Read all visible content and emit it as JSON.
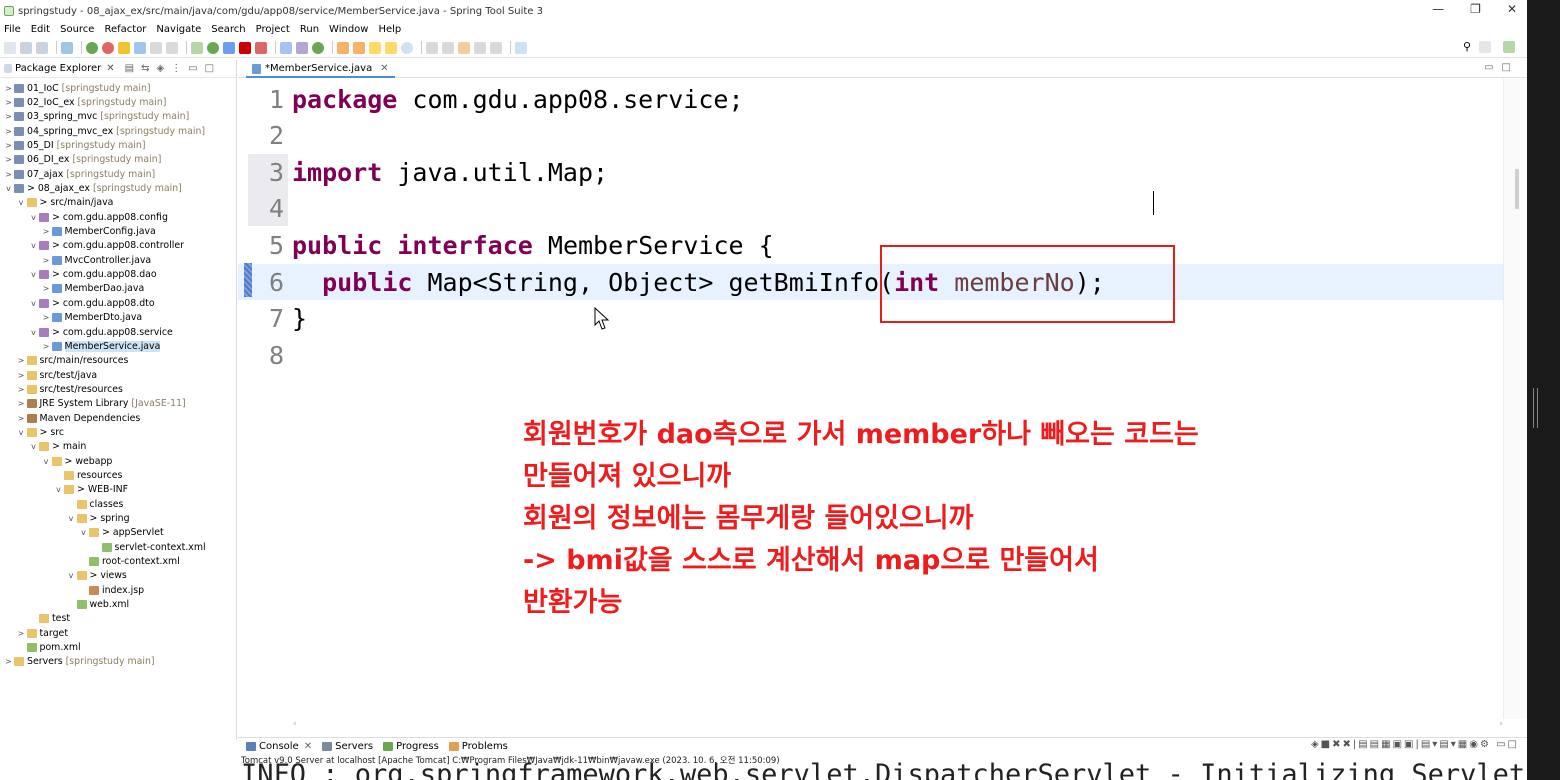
{
  "window": {
    "title": "springstudy - 08_ajax_ex/src/main/java/com/gdu/app08/service/MemberService.java - Spring Tool Suite 3",
    "controls": [
      "—",
      "❐",
      "✕"
    ]
  },
  "menubar": {
    "items": [
      "File",
      "Edit",
      "Source",
      "Refactor",
      "Navigate",
      "Search",
      "Project",
      "Run",
      "Window",
      "Help"
    ]
  },
  "package_explorer": {
    "title": "Package Explorer",
    "tree": [
      {
        "indent": 0,
        "twisty": ">",
        "icon": "project",
        "label": "01_IoC",
        "decoration": "[springstudy main]"
      },
      {
        "indent": 0,
        "twisty": ">",
        "icon": "project",
        "label": "02_IoC_ex",
        "decoration": "[springstudy main]"
      },
      {
        "indent": 0,
        "twisty": ">",
        "icon": "project",
        "label": "03_spring_mvc",
        "decoration": "[springstudy main]"
      },
      {
        "indent": 0,
        "twisty": ">",
        "icon": "project",
        "label": "04_spring_mvc_ex",
        "decoration": "[springstudy main]"
      },
      {
        "indent": 0,
        "twisty": ">",
        "icon": "project",
        "label": "05_DI",
        "decoration": "[springstudy main]"
      },
      {
        "indent": 0,
        "twisty": ">",
        "icon": "project",
        "label": "06_DI_ex",
        "decoration": "[springstudy main]"
      },
      {
        "indent": 0,
        "twisty": ">",
        "icon": "project",
        "label": "07_ajax",
        "decoration": "[springstudy main]"
      },
      {
        "indent": 0,
        "twisty": "v",
        "icon": "project",
        "label": "> 08_ajax_ex",
        "decoration": "[springstudy main]"
      },
      {
        "indent": 1,
        "twisty": "v",
        "icon": "folder",
        "label": "> src/main/java",
        "decoration": ""
      },
      {
        "indent": 2,
        "twisty": "v",
        "icon": "pkg",
        "label": "> com.gdu.app08.config",
        "decoration": ""
      },
      {
        "indent": 3,
        "twisty": ">",
        "icon": "java",
        "label": "MemberConfig.java",
        "decoration": ""
      },
      {
        "indent": 2,
        "twisty": "v",
        "icon": "pkg",
        "label": "> com.gdu.app08.controller",
        "decoration": ""
      },
      {
        "indent": 3,
        "twisty": ">",
        "icon": "java",
        "label": "MvcController.java",
        "decoration": ""
      },
      {
        "indent": 2,
        "twisty": "v",
        "icon": "pkg",
        "label": "> com.gdu.app08.dao",
        "decoration": ""
      },
      {
        "indent": 3,
        "twisty": ">",
        "icon": "java",
        "label": "MemberDao.java",
        "decoration": ""
      },
      {
        "indent": 2,
        "twisty": "v",
        "icon": "pkg",
        "label": "> com.gdu.app08.dto",
        "decoration": ""
      },
      {
        "indent": 3,
        "twisty": ">",
        "icon": "java",
        "label": "MemberDto.java",
        "decoration": ""
      },
      {
        "indent": 2,
        "twisty": "v",
        "icon": "pkg",
        "label": "> com.gdu.app08.service",
        "decoration": ""
      },
      {
        "indent": 3,
        "twisty": ">",
        "icon": "java",
        "label": "MemberService.java",
        "decoration": "",
        "selected": true
      },
      {
        "indent": 1,
        "twisty": ">",
        "icon": "folder",
        "label": "src/main/resources",
        "decoration": ""
      },
      {
        "indent": 1,
        "twisty": ">",
        "icon": "folder",
        "label": "src/test/java",
        "decoration": ""
      },
      {
        "indent": 1,
        "twisty": ">",
        "icon": "folder",
        "label": "src/test/resources",
        "decoration": ""
      },
      {
        "indent": 1,
        "twisty": ">",
        "icon": "lib",
        "label": "JRE System Library",
        "decoration": "[JavaSE-11]"
      },
      {
        "indent": 1,
        "twisty": ">",
        "icon": "lib",
        "label": "Maven Dependencies",
        "decoration": ""
      },
      {
        "indent": 1,
        "twisty": "v",
        "icon": "folder",
        "label": "> src",
        "decoration": ""
      },
      {
        "indent": 2,
        "twisty": "v",
        "icon": "folder",
        "label": "> main",
        "decoration": ""
      },
      {
        "indent": 3,
        "twisty": "v",
        "icon": "folder",
        "label": "> webapp",
        "decoration": ""
      },
      {
        "indent": 4,
        "twisty": "",
        "icon": "folder",
        "label": "resources",
        "decoration": ""
      },
      {
        "indent": 4,
        "twisty": "v",
        "icon": "folder",
        "label": "> WEB-INF",
        "decoration": ""
      },
      {
        "indent": 5,
        "twisty": "",
        "icon": "folder",
        "label": "classes",
        "decoration": ""
      },
      {
        "indent": 5,
        "twisty": "v",
        "icon": "folder",
        "label": "> spring",
        "decoration": ""
      },
      {
        "indent": 6,
        "twisty": "v",
        "icon": "folder",
        "label": "> appServlet",
        "decoration": ""
      },
      {
        "indent": 7,
        "twisty": "",
        "icon": "xml",
        "label": "servlet-context.xml",
        "decoration": ""
      },
      {
        "indent": 6,
        "twisty": "",
        "icon": "xml",
        "label": "root-context.xml",
        "decoration": ""
      },
      {
        "indent": 5,
        "twisty": "v",
        "icon": "folder",
        "label": "> views",
        "decoration": ""
      },
      {
        "indent": 6,
        "twisty": "",
        "icon": "jsp",
        "label": "index.jsp",
        "decoration": ""
      },
      {
        "indent": 5,
        "twisty": "",
        "icon": "xml",
        "label": "web.xml",
        "decoration": ""
      },
      {
        "indent": 2,
        "twisty": "",
        "icon": "folder",
        "label": "test",
        "decoration": ""
      },
      {
        "indent": 1,
        "twisty": ">",
        "icon": "folder",
        "label": "target",
        "decoration": ""
      },
      {
        "indent": 1,
        "twisty": "",
        "icon": "xml",
        "label": "pom.xml",
        "decoration": ""
      },
      {
        "indent": 0,
        "twisty": ">",
        "icon": "folder",
        "label": "Servers",
        "decoration": "[springstudy main]"
      }
    ]
  },
  "editor": {
    "tab_label": "*MemberService.java",
    "tab_close": "✕",
    "lines": [
      {
        "num": "1",
        "tokens": [
          {
            "t": "package",
            "c": "kw"
          },
          {
            "t": " com.gdu.app08.service;",
            "c": ""
          }
        ]
      },
      {
        "num": "2",
        "tokens": []
      },
      {
        "num": "3",
        "tokens": [
          {
            "t": "import",
            "c": "kw"
          },
          {
            "t": " java.util.Map;",
            "c": ""
          }
        ]
      },
      {
        "num": "4",
        "tokens": []
      },
      {
        "num": "5",
        "tokens": [
          {
            "t": "public",
            "c": "kw"
          },
          {
            "t": " ",
            "c": ""
          },
          {
            "t": "interface",
            "c": "kw"
          },
          {
            "t": " MemberService {",
            "c": ""
          }
        ]
      },
      {
        "num": "6",
        "tokens": [
          {
            "t": "  ",
            "c": ""
          },
          {
            "t": "public",
            "c": "kw"
          },
          {
            "t": " Map<String, Object> getBmiInfo(",
            "c": ""
          },
          {
            "t": "int",
            "c": "kw"
          },
          {
            "t": " ",
            "c": ""
          },
          {
            "t": "memberNo",
            "c": "param"
          },
          {
            "t": ");",
            "c": ""
          }
        ],
        "current": true
      },
      {
        "num": "7",
        "tokens": [
          {
            "t": "}",
            "c": ""
          }
        ]
      },
      {
        "num": "8",
        "tokens": []
      }
    ]
  },
  "annotation": {
    "color": "#ee1c1c",
    "lines": [
      "회원번호가 dao측으로 가서 member하나 빼오는 코드는",
      "만들어져 있으니까",
      "회원의 정보에는 몸무게랑 들어있으니까",
      "-> bmi값을 스스로 계산해서 map으로 만들어서",
      "반환가능"
    ]
  },
  "console": {
    "tabs": [
      {
        "label": "Console",
        "icon": "console-icon"
      },
      {
        "label": "Servers",
        "icon": "servers-icon"
      },
      {
        "label": "Progress",
        "icon": "progress-icon"
      },
      {
        "label": "Problems",
        "icon": "problems-icon"
      }
    ],
    "status": "Tomcat v9.0 Server at localhost [Apache Tomcat] C:₩Program Files₩Java₩jdk-11₩bin₩javaw.exe  (2023. 10. 6. 오전 11:50:09)",
    "output": "INFO : org.springframework.web.servlet.DispatcherServlet - Initializing Servlet"
  }
}
